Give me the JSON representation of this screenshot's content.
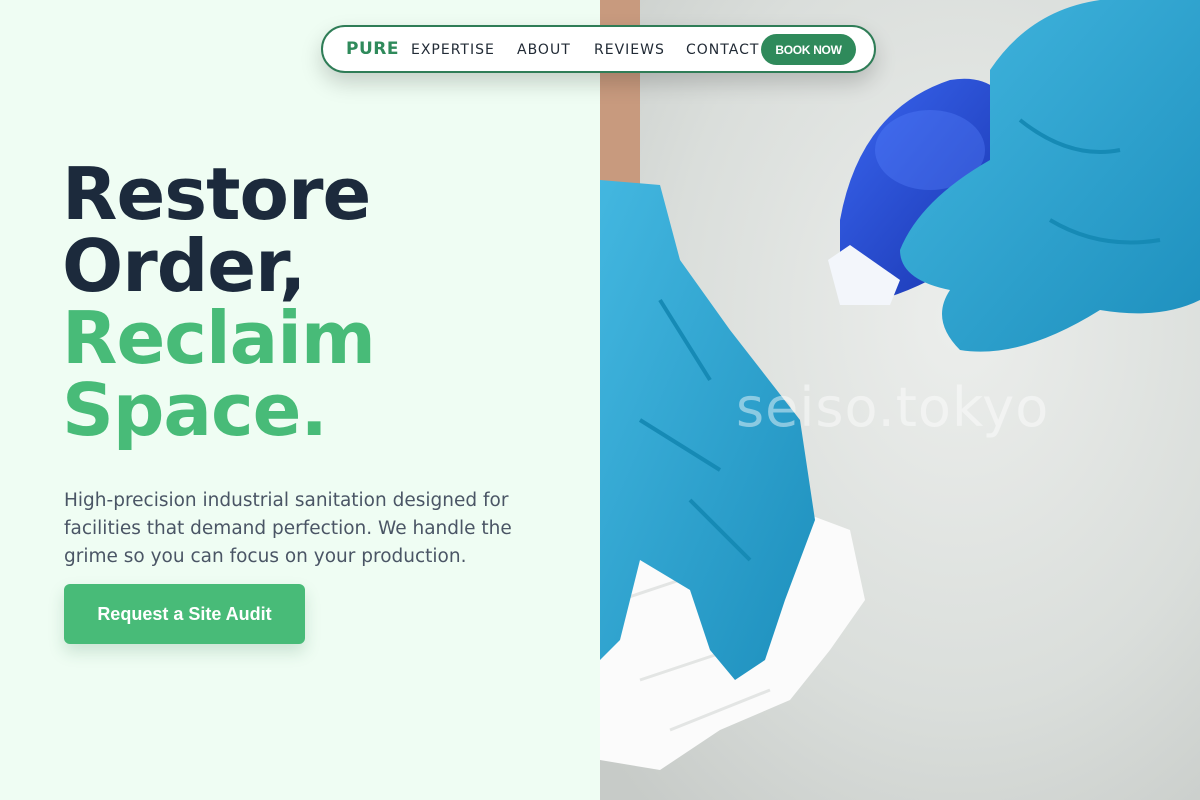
{
  "nav": {
    "brand": "PURE",
    "links": [
      "EXPERTISE",
      "ABOUT",
      "REVIEWS",
      "CONTACT"
    ],
    "book_label": "BOOK NOW"
  },
  "hero": {
    "headline_dark": [
      "Restore",
      "Order,"
    ],
    "headline_green": [
      "Reclaim",
      "Space."
    ],
    "description": "High-precision industrial sanitation designed for facilities that demand perfection. We handle the grime so you can focus on your production.",
    "cta_label": "Request a Site Audit"
  },
  "image": {
    "watermark": "seiso.tokyo",
    "subject_icons": [
      "gloved-hand-icon",
      "spray-bottle-icon",
      "paper-towel-icon"
    ]
  },
  "colors": {
    "brand_green": "#2f8a5b",
    "accent_green": "#48bb78",
    "heading_dark": "#1c2a3c",
    "left_bg": "#effdf3",
    "glove_blue": "#2aa7d4",
    "bottle_blue": "#2147d8"
  }
}
